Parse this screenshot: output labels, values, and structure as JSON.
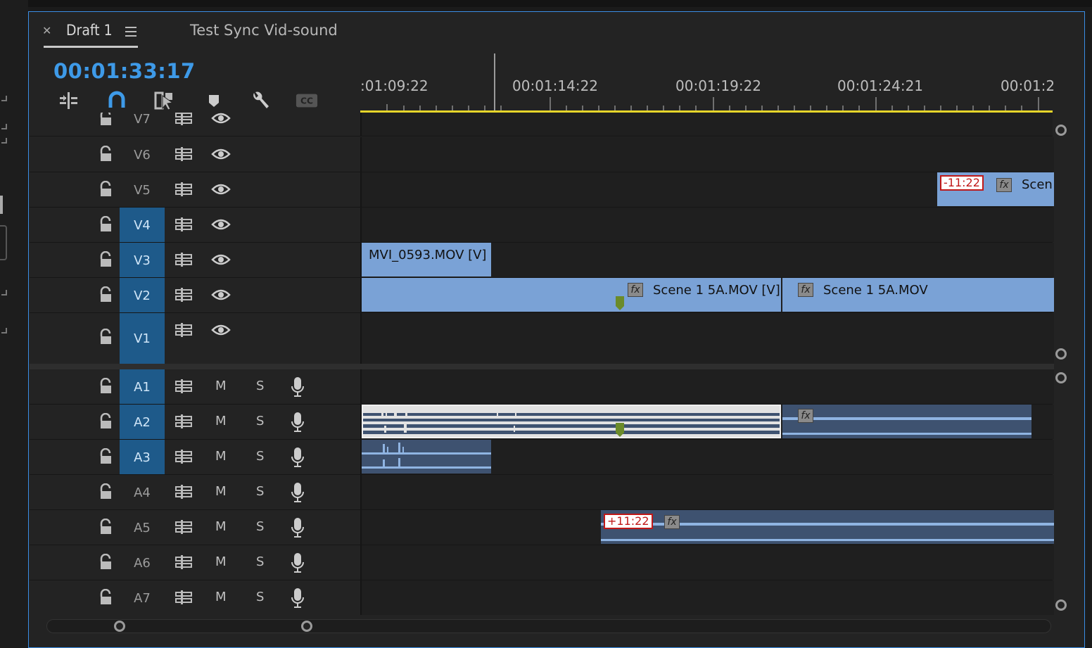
{
  "tabs": {
    "active_label": "Draft 1",
    "second_label": "Test Sync Vid-sound"
  },
  "timecode": "00:01:33:17",
  "toolbar": {
    "icons": [
      "insert-overwrite-icon",
      "snap-icon",
      "linked-selection-icon",
      "add-marker-icon",
      "wrench-icon",
      "captions-icon"
    ]
  },
  "ruler": {
    "labels": [
      ":01:09:22",
      "00:01:14:22",
      "00:01:19:22",
      "00:01:24:21",
      "00:01:2"
    ]
  },
  "video_tracks": [
    {
      "name": "V7",
      "targeted": false
    },
    {
      "name": "V6",
      "targeted": false
    },
    {
      "name": "V5",
      "targeted": false
    },
    {
      "name": "V4",
      "targeted": true
    },
    {
      "name": "V3",
      "targeted": true
    },
    {
      "name": "V2",
      "targeted": true
    },
    {
      "name": "V1",
      "targeted": true
    }
  ],
  "audio_tracks": [
    {
      "name": "A1",
      "targeted": true,
      "mute": "M",
      "solo": "S"
    },
    {
      "name": "A2",
      "targeted": true,
      "mute": "M",
      "solo": "S"
    },
    {
      "name": "A3",
      "targeted": true,
      "mute": "M",
      "solo": "S"
    },
    {
      "name": "A4",
      "targeted": false,
      "mute": "M",
      "solo": "S"
    },
    {
      "name": "A5",
      "targeted": false,
      "mute": "M",
      "solo": "S"
    },
    {
      "name": "A6",
      "targeted": false,
      "mute": "M",
      "solo": "S"
    },
    {
      "name": "A7",
      "targeted": false,
      "mute": "M",
      "solo": "S"
    }
  ],
  "clips": {
    "v5_offset": "-11:22",
    "v5_label": "Scen",
    "v3_label": "MVI_0593.MOV [V]",
    "v2_a_label": "Scene 1 5A.MOV [V]",
    "v2_b_label": "Scene 1 5A.MOV",
    "a5_offset": "+11:22",
    "fx": "fx"
  },
  "colors": {
    "accent": "#3e9ae8",
    "video_clip": "#7aa2d6",
    "audio_clip": "#3e5270",
    "work_area": "#e6d52a",
    "track_target": "#1e5a8a"
  }
}
